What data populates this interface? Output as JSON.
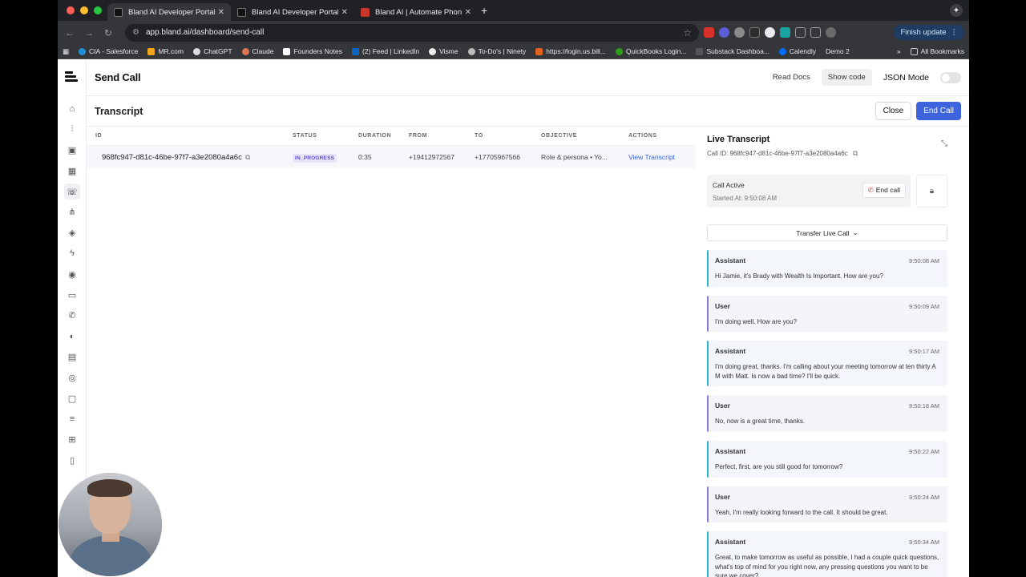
{
  "browser": {
    "tabs": [
      {
        "title": "Bland AI Developer Portal",
        "active": true
      },
      {
        "title": "Bland AI Developer Portal",
        "active": false
      },
      {
        "title": "Bland AI | Automate Phone Ca",
        "active": false
      }
    ],
    "url": "app.bland.ai/dashboard/send-call",
    "finish_update": "Finish update",
    "bookmarks": [
      "CIA - Salesforce",
      "MR.com",
      "ChatGPT",
      "Claude",
      "Founders Notes",
      "(2) Feed | LinkedIn",
      "Visme",
      "To-Do's | Ninety",
      "https://login.us.bill...",
      "QuickBooks Login...",
      "Substack Dashboa...",
      "Calendly",
      "Demo 2"
    ],
    "all_bookmarks": "All Bookmarks"
  },
  "header": {
    "title": "Send Call",
    "read_docs": "Read Docs",
    "show_code": "Show code",
    "json_mode": "JSON Mode"
  },
  "content": {
    "title": "Transcript",
    "close": "Close",
    "end_call": "End Call"
  },
  "table": {
    "columns": [
      "ID",
      "STATUS",
      "DURATION",
      "FROM",
      "TO",
      "OBJECTIVE",
      "ACTIONS"
    ],
    "row": {
      "id": "968fc947-d81c-46be-97f7-a3e2080a4a6c",
      "status": "IN_PROGRESS",
      "duration": "0:35",
      "from": "+19412972567",
      "to": "+17705967566",
      "objective": "Role & persona • Yo...",
      "action": "View Transcript"
    }
  },
  "live": {
    "title": "Live Transcript",
    "call_id": "Call ID: 968fc947-d81c-46be-97f7-a3e2080a4a6c",
    "active_title": "Call Active",
    "started_at": "Started At: 9:50:08 AM",
    "end_call": "End call",
    "transfer": "Transfer Live Call",
    "messages": [
      {
        "role": "Assistant",
        "time": "9:50:08 AM",
        "text": "Hi Jamie, it's Brady with Wealth Is Important. How are you?"
      },
      {
        "role": "User",
        "time": "9:50:09 AM",
        "text": "I'm doing well. How are you?"
      },
      {
        "role": "Assistant",
        "time": "9:50:17 AM",
        "text": "I'm doing great, thanks. I'm calling about your meeting tomorrow at ten thirty A M with Matt. Is now a bad time? I'll be quick."
      },
      {
        "role": "User",
        "time": "9:50:18 AM",
        "text": "No, now is a great time, thanks."
      },
      {
        "role": "Assistant",
        "time": "9:50:22 AM",
        "text": "Perfect, first, are you still good for tomorrow?"
      },
      {
        "role": "User",
        "time": "9:50:24 AM",
        "text": "Yeah, I'm really looking forward to the call. It should be great."
      },
      {
        "role": "Assistant",
        "time": "9:50:34 AM",
        "text": "Great, to make tomorrow as useful as possible, I had a couple quick questions, what's top of mind for you right now, any pressing questions you want to be sure we cover?"
      }
    ]
  },
  "colors": {
    "primary": "#3d63dd",
    "assistant_accent": "#2fb5c9",
    "user_accent": "#8b7be0",
    "status_badge": "#5b4dd6"
  }
}
